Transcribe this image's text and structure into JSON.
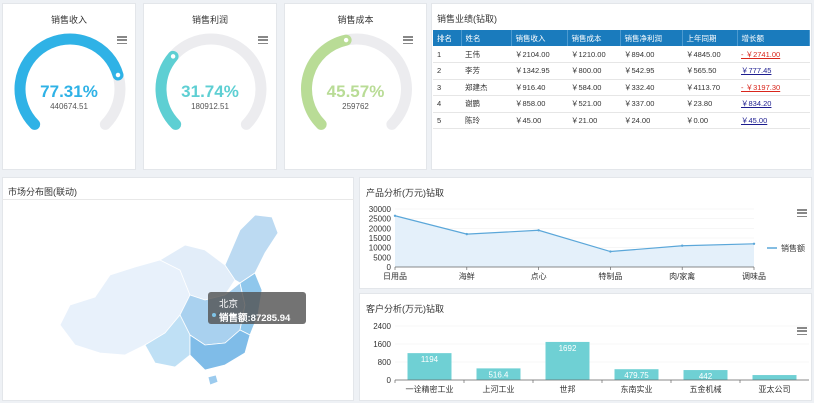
{
  "gauges": [
    {
      "title": "销售收入",
      "percent": "77.31%",
      "value": "440674.51",
      "fraction": 0.7731,
      "color": "#2fb2e6"
    },
    {
      "title": "销售利润",
      "percent": "31.74%",
      "value": "180912.51",
      "fraction": 0.3174,
      "color": "#5ecfd3"
    },
    {
      "title": "销售成本",
      "percent": "45.57%",
      "value": "259762",
      "fraction": 0.4557,
      "color": "#b9dc96"
    }
  ],
  "sales_table": {
    "title": "销售业绩(钻取)",
    "headers": [
      "排名",
      "姓名",
      "销售收入",
      "销售成本",
      "销售净利润",
      "上年同期",
      "增长额"
    ],
    "rows": [
      [
        "1",
        "王伟",
        "￥2104.00",
        "￥1210.00",
        "￥894.00",
        "￥4845.00",
        "- ￥2741.00"
      ],
      [
        "2",
        "李芳",
        "￥1342.95",
        "￥800.00",
        "￥542.95",
        "￥565.50",
        "￥777.45"
      ],
      [
        "3",
        "郑建杰",
        "￥916.40",
        "￥584.00",
        "￥332.40",
        "￥4113.70",
        "- ￥3197.30"
      ],
      [
        "4",
        "谢鹏",
        "￥858.00",
        "￥521.00",
        "￥337.00",
        "￥23.80",
        "￥834.20"
      ],
      [
        "5",
        "陈玲",
        "￥45.00",
        "￥21.00",
        "￥24.00",
        "￥0.00",
        "￥45.00"
      ]
    ]
  },
  "map_panel": {
    "title": "市场分布图(联动)",
    "tooltip_city": "北京",
    "tooltip_value": "销售额:87285.94"
  },
  "product_chart_panel": {
    "title": "产品分析(万元)钻取"
  },
  "customer_chart_panel": {
    "title": "客户分析(万元)钻取"
  },
  "chart_data": [
    {
      "type": "area",
      "categories": [
        "日用品",
        "海鲜",
        "点心",
        "特制品",
        "肉/家禽",
        "调味品"
      ],
      "series": [
        {
          "name": "销售额",
          "values": [
            26500,
            17000,
            19000,
            8000,
            11000,
            12000
          ]
        }
      ],
      "yticks": [
        "30000",
        "25000",
        "20000",
        "15000",
        "10000",
        "5000",
        "0"
      ],
      "ylim": [
        0,
        30000
      ],
      "legend": "right",
      "color": "#5ba7d9"
    },
    {
      "type": "bar",
      "categories": [
        "一诠精密工业",
        "上河工业",
        "世邦",
        "东南实业",
        "五金机械",
        "亚太公司"
      ],
      "values": [
        1194,
        516.4,
        1692,
        479.75,
        442,
        220
      ],
      "labels": [
        "1194",
        "516.4",
        "1692",
        "479.75",
        "442",
        ""
      ],
      "yticks": [
        "2400",
        "1600",
        "800",
        "0"
      ],
      "ylim": [
        0,
        2400
      ],
      "color": "#6fd0d4"
    }
  ]
}
